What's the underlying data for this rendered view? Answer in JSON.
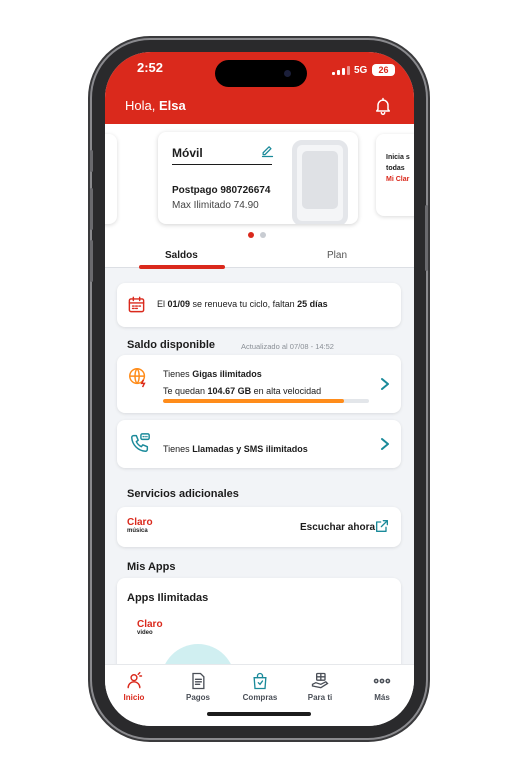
{
  "status": {
    "time": "2:52",
    "network": "5G",
    "battery": "26"
  },
  "header": {
    "greeting_prefix": "Hola,",
    "user_name": "Elsa"
  },
  "carousel": {
    "card": {
      "title": "Móvil",
      "line1_label": "Postpago",
      "line1_number": "980726674",
      "line2": "Max Ilimitado 74.90"
    },
    "next_card": {
      "line1": "Inicia s",
      "line2": "todas",
      "line3": "Mi Clar"
    },
    "page_count": 2,
    "active_page": 1
  },
  "tabs": {
    "saldos": "Saldos",
    "plan": "Plan"
  },
  "renewal": {
    "prefix": "El ",
    "date": "01/09",
    "middle": " se renueva tu ciclo, faltan ",
    "days": "25 días"
  },
  "saldo": {
    "title": "Saldo disponible",
    "updated": "Actualizado al 07/08 - 14:52",
    "gigas_prefix": "Tienes ",
    "gigas_bold": "Gigas ilimitados",
    "remaining_prefix": "Te quedan ",
    "remaining_value": "104.67 GB",
    "remaining_suffix": " en alta velocidad",
    "progress_fraction": 0.88,
    "calls_prefix": "Tienes ",
    "calls_bold": "Llamadas y SMS ilimitados"
  },
  "servicios": {
    "title": "Servicios adicionales",
    "logo_main": "Claro",
    "logo_sub": "música",
    "action": "Escuchar ahora"
  },
  "apps": {
    "title": "Mis Apps",
    "subtitle": "Apps Ilimitadas",
    "logo_main": "Claro",
    "logo_sub": "video"
  },
  "nav": {
    "inicio": "Inicio",
    "pagos": "Pagos",
    "compras": "Compras",
    "para_ti": "Para ti",
    "mas": "Más"
  },
  "colors": {
    "brand": "#da291c",
    "accent": "#1a8a9a",
    "progress": "#ff8c1a"
  },
  "icons": [
    "bell-icon",
    "edit-icon",
    "calendar-icon",
    "globe-icon",
    "phone-chat-icon",
    "chevron-right-icon",
    "external-link-icon",
    "home-user-icon",
    "receipt-icon",
    "shopping-bag-icon",
    "gift-hand-icon",
    "more-dots-icon"
  ]
}
